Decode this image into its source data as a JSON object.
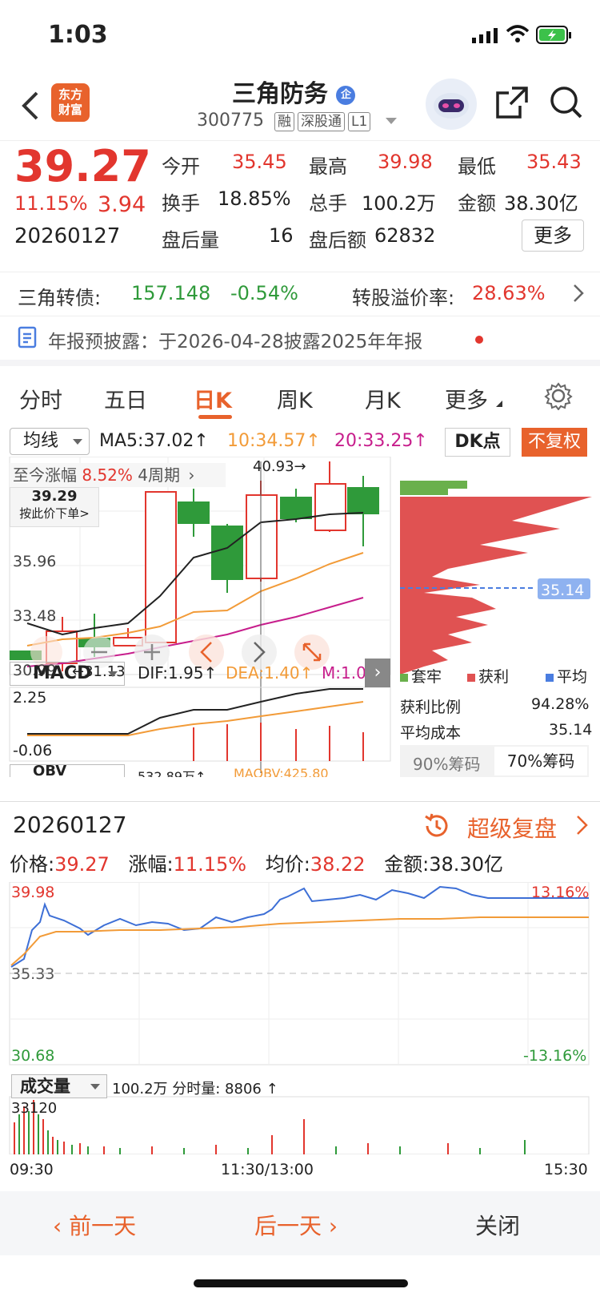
{
  "status": {
    "time": "1:03"
  },
  "nav": {
    "title": "三角防务",
    "code": "300775",
    "tags": [
      "融",
      "深股通",
      "L1"
    ],
    "badge": "企",
    "logo_line1": "东方",
    "logo_line2": "财富"
  },
  "quote": {
    "price": "39.27",
    "pct": "11.15%",
    "chg": "3.94",
    "date": "20260127",
    "open_label": "今开",
    "open": "35.45",
    "high_label": "最高",
    "high": "39.98",
    "low_label": "最低",
    "low": "35.43",
    "turn_label": "换手",
    "turn": "18.85%",
    "vol_label": "总手",
    "vol": "100.2万",
    "amt_label": "金额",
    "amt": "38.30亿",
    "ah_vol_label": "盘后量",
    "ah_vol": "16",
    "ah_amt_label": "盘后额",
    "ah_amt": "62832",
    "more": "更多"
  },
  "bond": {
    "label": "三角转债:",
    "price": "157.148",
    "pct": "-0.54%",
    "premium_label": "转股溢价率:",
    "premium": "28.63%"
  },
  "notice": {
    "text": "年报预披露：于2026-04-28披露2025年年报"
  },
  "tabs": [
    "分时",
    "五日",
    "日K",
    "周K",
    "月K",
    "更多"
  ],
  "kline": {
    "ma_select": "均线",
    "ma5": "MA5:37.02↑",
    "ma10": "10:34.57↑",
    "ma20": "20:33.25↑",
    "dk": "DK点",
    "fq": "不复权",
    "gain_label": "至今涨幅",
    "gain": "8.52%",
    "period": "4周期",
    "price_box": "39.29",
    "price_box_sub": "按此价下单>",
    "high_mark": "40.93→",
    "low_mark": "←31.13",
    "y1": "35.96",
    "y2": "33.48",
    "y3": "30.99"
  },
  "macd": {
    "select": "MACD",
    "dif": "DIF:1.95↑",
    "dea": "DEA:1.40↑",
    "m": "M:1.0...",
    "y1": "2.25",
    "y2": "-0.06"
  },
  "obv": {
    "select": "OBV",
    "val": "532.89万↑",
    "maobv": "MAOBV:425.80"
  },
  "chip": {
    "legend": [
      "套牢",
      "获利",
      "平均"
    ],
    "avg_tag": "35.14",
    "ratio_label": "获利比例",
    "ratio": "94.28%",
    "cost_label": "平均成本",
    "cost": "35.14",
    "tab90": "90%筹码",
    "tab70": "70%筹码"
  },
  "panel": {
    "date": "20260127",
    "replay": "超级复盘",
    "price_label": "价格:",
    "price": "39.27",
    "pct_label": "涨幅:",
    "pct": "11.15%",
    "avg_label": "均价:",
    "avg": "38.22",
    "amt_label": "金额:",
    "amt": "38.30亿",
    "ytop": "39.98",
    "ymid": "35.33",
    "ybot": "30.68",
    "ptop": "13.16%",
    "pbot": "-13.16%",
    "vol_select": "成交量",
    "vol_info": "100.2万 分时量: 8806 ↑",
    "vol_max": "33120",
    "t0": "09:30",
    "t1": "11:30/13:00",
    "t2": "15:30"
  },
  "buttons": {
    "prev": "前一天",
    "next": "后一天",
    "close": "关闭"
  },
  "colors": {
    "red": "#e2362e",
    "green": "#2f9a3a",
    "orange": "#f29b38",
    "accent": "#e8622c"
  }
}
